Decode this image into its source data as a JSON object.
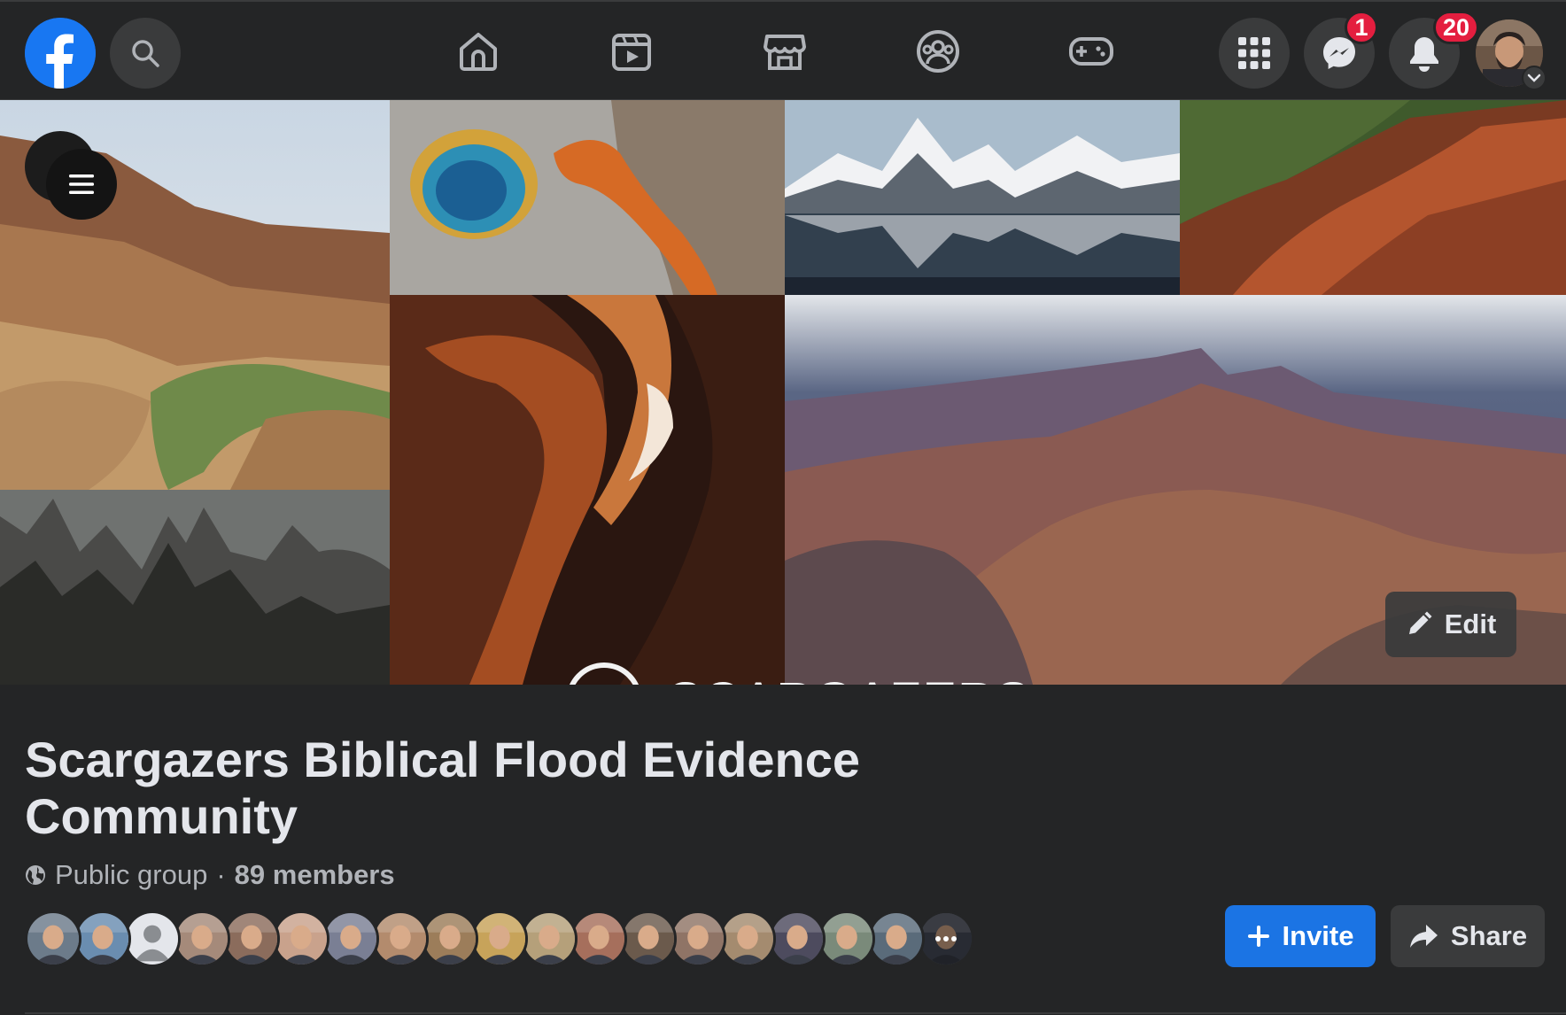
{
  "nav": {
    "notifications": {
      "messenger_count": "1",
      "alerts_count": "20"
    },
    "icons": [
      "facebook-logo",
      "search-icon",
      "home-icon",
      "watch-icon",
      "marketplace-icon",
      "groups-icon",
      "gaming-icon",
      "menu-grid-icon",
      "messenger-icon",
      "bell-icon",
      "chevron-down-icon"
    ]
  },
  "cover": {
    "brand_text": "SCARGAZERS",
    "edit_label": "Edit"
  },
  "group": {
    "title": "Scargazers Biblical Flood Evidence Community",
    "privacy": "Public group",
    "separator": "·",
    "members": "89 members",
    "member_face_colors": [
      "#6c7b8a",
      "#6a8db0",
      "#b0b3b8",
      "#a58a7a",
      "#8b6c5c",
      "#c9a28c",
      "#7a7f94",
      "#b38b6d",
      "#9c7d5a",
      "#c7a35a",
      "#b5a07a",
      "#a66f5c",
      "#6b5a4c",
      "#8f7466",
      "#a48b6f",
      "#4d4b5e",
      "#7a8a7a",
      "#5a6b7a",
      "#4a4f5e"
    ]
  },
  "actions": {
    "invite_label": "Invite",
    "share_label": "Share"
  },
  "colors": {
    "accent": "#1b74e4",
    "badge": "#e41e3f",
    "surface": "#242526",
    "button": "#3a3b3c"
  }
}
